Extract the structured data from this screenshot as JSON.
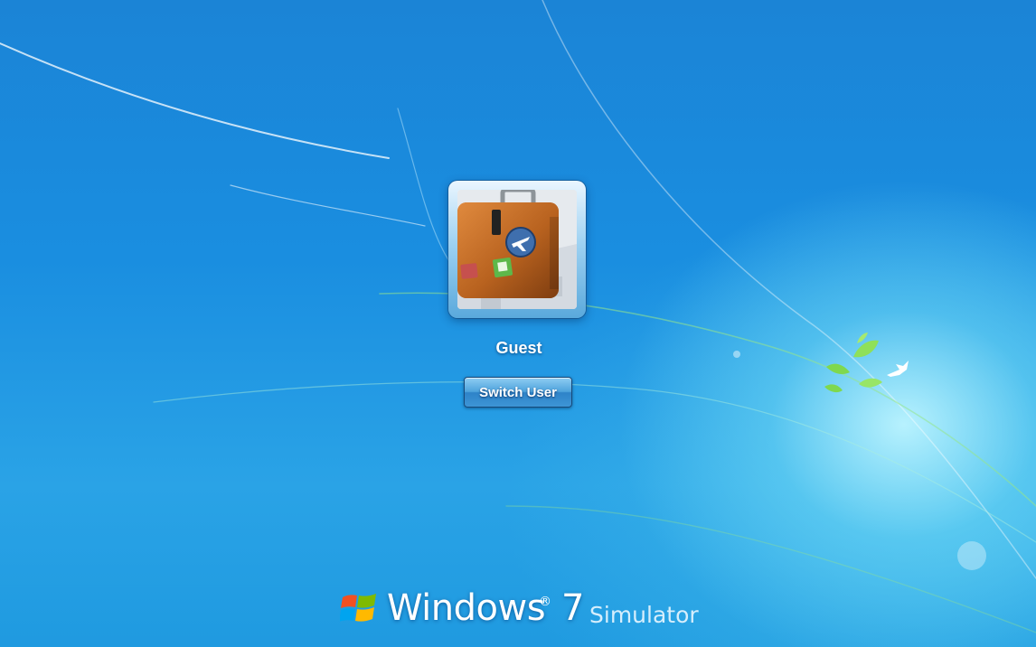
{
  "screen": {
    "user_name": "Guest",
    "switch_user_label": "Switch User"
  },
  "branding": {
    "word": "Windows",
    "registered": "®",
    "version": "7",
    "subtitle": "Simulator"
  },
  "icons": {
    "avatar": "suitcase-icon",
    "logo": "windows-flag-icon"
  },
  "colors": {
    "background": "#1a8ee0",
    "glow": "#bff5ff",
    "button": "#4ea3dc",
    "flag_red": "#f25022",
    "flag_green": "#7fba00",
    "flag_blue": "#00a4ef",
    "flag_yellow": "#ffb900"
  }
}
